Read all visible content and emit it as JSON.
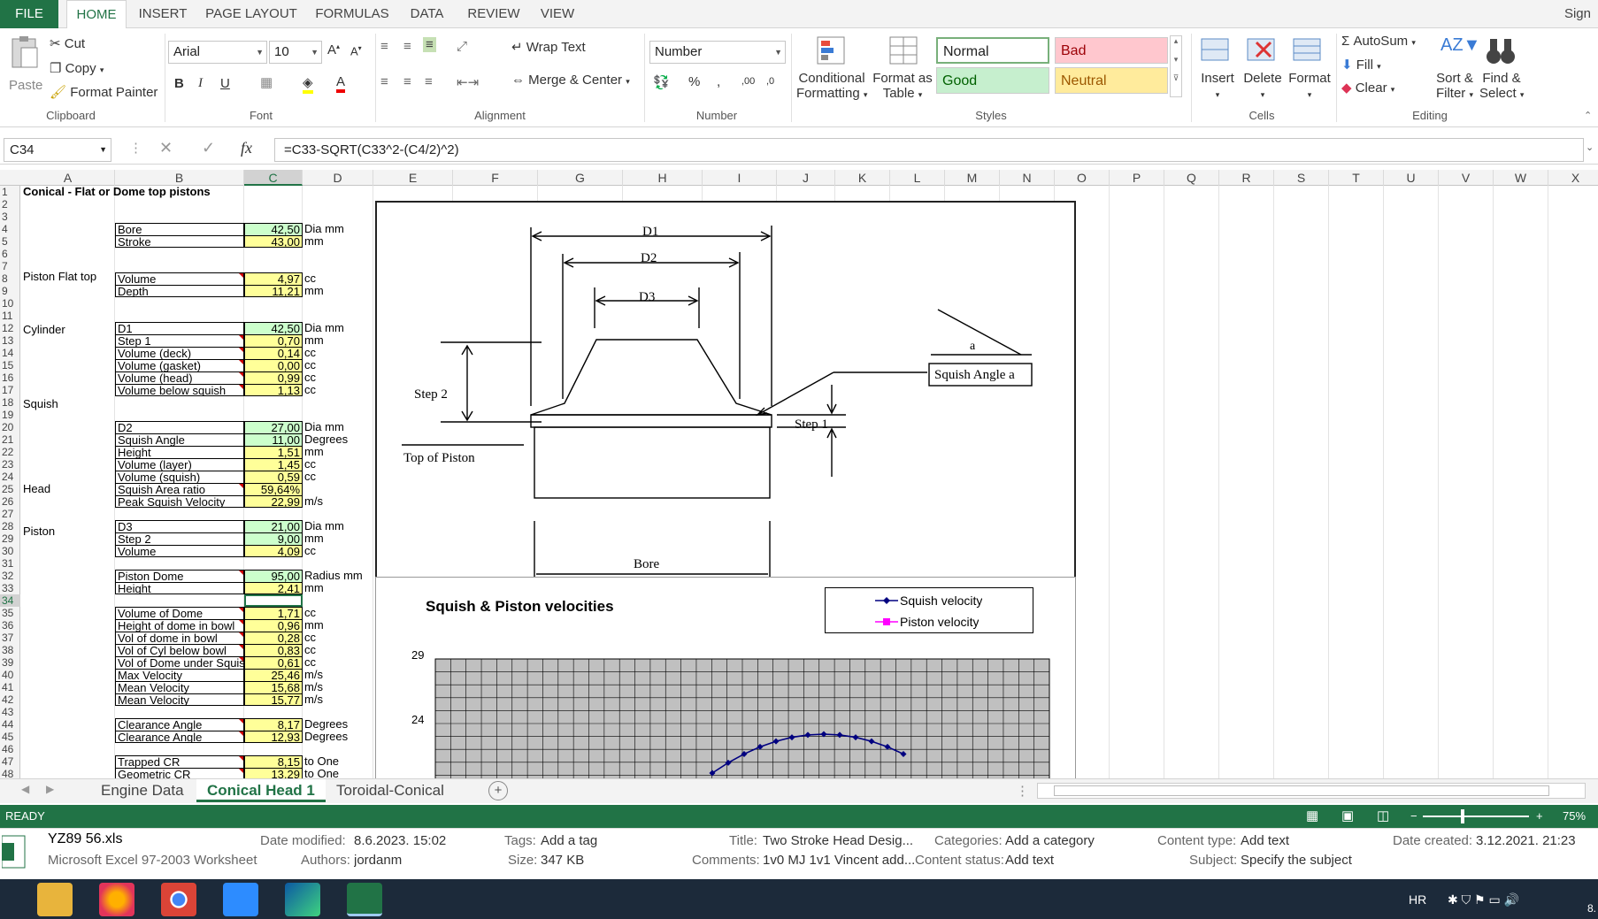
{
  "ribbon": {
    "tabs": [
      "FILE",
      "HOME",
      "INSERT",
      "PAGE LAYOUT",
      "FORMULAS",
      "DATA",
      "REVIEW",
      "VIEW"
    ],
    "active_tab": "HOME",
    "signin": "Sign",
    "clipboard": {
      "paste": "Paste",
      "cut": "Cut",
      "copy": "Copy",
      "format_painter": "Format Painter",
      "label": "Clipboard"
    },
    "font": {
      "name": "Arial",
      "size": "10",
      "label": "Font"
    },
    "alignment": {
      "wrap": "Wrap Text",
      "merge": "Merge & Center",
      "label": "Alignment"
    },
    "number": {
      "format": "Number",
      "label": "Number"
    },
    "styles": {
      "conditional": "Conditional",
      "conditional2": "Formatting",
      "format_as": "Format as",
      "format_as2": "Table",
      "normal": "Normal",
      "bad": "Bad",
      "good": "Good",
      "neutral": "Neutral",
      "label": "Styles"
    },
    "cells": {
      "insert": "Insert",
      "delete": "Delete",
      "format": "Format",
      "label": "Cells"
    },
    "editing": {
      "autosum": "AutoSum",
      "fill": "Fill",
      "clear": "Clear",
      "sort": "Sort &",
      "sort2": "Filter",
      "find": "Find &",
      "find2": "Select",
      "label": "Editing"
    }
  },
  "formula_bar": {
    "name_box": "C34",
    "formula": "=C33-SQRT(C33^2-(C4/2)^2)",
    "fx": "fx"
  },
  "columns": [
    "A",
    "B",
    "C",
    "D",
    "E",
    "F",
    "G",
    "H",
    "I",
    "J",
    "K",
    "L",
    "M",
    "N",
    "O",
    "P",
    "Q",
    "R",
    "S",
    "T",
    "U",
    "V",
    "W",
    "X"
  ],
  "selected_cell": {
    "col": "C",
    "row": 34
  },
  "sheet": {
    "title": "Conical - Flat or Dome top pistons",
    "sections": {
      "r8": "Piston Flat top",
      "r13": "Cylinder",
      "r20": "Squish",
      "r28": "Head",
      "r32": "Piston"
    },
    "rows": [
      {
        "r": 4,
        "label": "Bore",
        "value": "42,50",
        "unit": "Dia  mm",
        "green": true
      },
      {
        "r": 5,
        "label": "Stroke",
        "value": "43,00",
        "unit": "mm",
        "green": false
      },
      {
        "r": 8,
        "label": "Volume",
        "value": "4,97",
        "unit": "cc",
        "green": false
      },
      {
        "r": 9,
        "label": "Depth",
        "value": "11,21",
        "unit": "mm",
        "green": false
      },
      {
        "r": 12,
        "label": "D1",
        "value": "42,50",
        "unit": "Dia mm",
        "green": true
      },
      {
        "r": 13,
        "label": "Step 1",
        "value": "0,70",
        "unit": "mm",
        "green": false
      },
      {
        "r": 14,
        "label": "Volume (deck)",
        "value": "0,14",
        "unit": "cc",
        "green": false
      },
      {
        "r": 15,
        "label": "Volume (gasket)",
        "value": "0,00",
        "unit": "cc",
        "green": false
      },
      {
        "r": 16,
        "label": "Volume (head)",
        "value": "0,99",
        "unit": "cc",
        "green": false
      },
      {
        "r": 17,
        "label": "Volume below squish",
        "value": "1,13",
        "unit": "cc",
        "green": false
      },
      {
        "r": 20,
        "label": "D2",
        "value": "27,00",
        "unit": "Dia mm",
        "green": true
      },
      {
        "r": 21,
        "label": "Squish Angle",
        "value": "11,00",
        "unit": "Degrees",
        "green": true
      },
      {
        "r": 22,
        "label": "Height",
        "value": "1,51",
        "unit": "mm",
        "green": false
      },
      {
        "r": 23,
        "label": "Volume (layer)",
        "value": "1,45",
        "unit": "cc",
        "green": false
      },
      {
        "r": 24,
        "label": "Volume (squish)",
        "value": "0,59",
        "unit": "cc",
        "green": false
      },
      {
        "r": 25,
        "label": "Squish Area ratio",
        "value": "59,64%",
        "unit": "",
        "green": false
      },
      {
        "r": 26,
        "label": "Peak Squish Velocity",
        "value": "22,99",
        "unit": "m/s",
        "green": false
      },
      {
        "r": 28,
        "label": "D3",
        "value": "21,00",
        "unit": "Dia mm",
        "green": true
      },
      {
        "r": 29,
        "label": "Step 2",
        "value": "9,00",
        "unit": "mm",
        "green": true
      },
      {
        "r": 30,
        "label": "Volume",
        "value": "4,09",
        "unit": "cc",
        "green": false
      },
      {
        "r": 32,
        "label": "Piston Dome",
        "value": "95,00",
        "unit": "Radius mm",
        "green": true
      },
      {
        "r": 33,
        "label": "Height",
        "value": "2,41",
        "unit": "mm",
        "green": false
      },
      {
        "r": 35,
        "label": "Volume of Dome",
        "value": "1,71",
        "unit": "cc",
        "green": false
      },
      {
        "r": 36,
        "label": "Height of dome in bowl",
        "value": "0,96",
        "unit": "mm",
        "green": false
      },
      {
        "r": 37,
        "label": "Vol of dome in bowl",
        "value": "0,28",
        "unit": "cc",
        "green": false
      },
      {
        "r": 38,
        "label": "Vol of Cyl below bowl",
        "value": "0,83",
        "unit": "cc",
        "green": false
      },
      {
        "r": 39,
        "label": "Vol of Dome under Squis",
        "value": "0,61",
        "unit": "cc",
        "green": false
      },
      {
        "r": 40,
        "label": "Max Velocity",
        "value": "25,46",
        "unit": "m/s",
        "green": false
      },
      {
        "r": 41,
        "label": "Mean Velocity",
        "value": "15,68",
        "unit": "m/s",
        "green": false
      },
      {
        "r": 42,
        "label": "Mean Velocity",
        "value": "15,77",
        "unit": "m/s",
        "green": false
      },
      {
        "r": 44,
        "label": "Clearance Angle",
        "value": "8,17",
        "unit": "Degrees",
        "green": false
      },
      {
        "r": 45,
        "label": "Clearance Angle",
        "value": "12,93",
        "unit": "Degrees",
        "green": false
      },
      {
        "r": 47,
        "label": "Trapped CR",
        "value": "8,15",
        "unit": " to One",
        "green": false
      },
      {
        "r": 48,
        "label": "Geometric CR",
        "value": "13,29",
        "unit": " to One",
        "green": false
      }
    ]
  },
  "diagram": {
    "d1": "D1",
    "d2": "D2",
    "d3": "D3",
    "step2": "Step 2",
    "step1": "Step 1",
    "top_of_piston": "Top of Piston",
    "bore": "Bore",
    "a": "a",
    "squish_angle": "Squish Angle a"
  },
  "chart_data": {
    "type": "line",
    "title": "Squish & Piston velocities",
    "series": [
      {
        "name": "Squish velocity",
        "color": "#000080"
      },
      {
        "name": "Piston velocity",
        "color": "#ff00ff"
      }
    ],
    "y_ticks_visible": [
      "29",
      "24"
    ],
    "grid": true
  },
  "sheet_tabs": [
    "Engine Data",
    "Conical Head 1",
    "Toroidal-Conical"
  ],
  "active_sheet": "Conical Head 1",
  "status": {
    "ready": "READY",
    "zoom": "75%"
  },
  "file_details": {
    "name": "YZ89 56.xls",
    "type": "Microsoft Excel 97-2003 Worksheet",
    "date_modified_k": "Date modified:",
    "date_modified": "8.6.2023. 15:02",
    "authors_k": "Authors:",
    "authors": "jordanm",
    "tags_k": "Tags:",
    "tags": "Add a tag",
    "size_k": "Size:",
    "size": "347 KB",
    "title_k": "Title:",
    "title": "Two Stroke Head Desig...",
    "comments_k": "Comments:",
    "comments": "1v0 MJ 1v1 Vincent add...",
    "categories_k": "Categories:",
    "categories": "Add a category",
    "content_status_k": "Content status:",
    "content_status": "Add text",
    "content_type_k": "Content type:",
    "content_type": "Add text",
    "subject_k": "Subject:",
    "subject": "Specify the subject",
    "date_created_k": "Date created:",
    "date_created": "3.12.2021. 21:23"
  },
  "taskbar": {
    "lang": "HR",
    "time": "8."
  }
}
